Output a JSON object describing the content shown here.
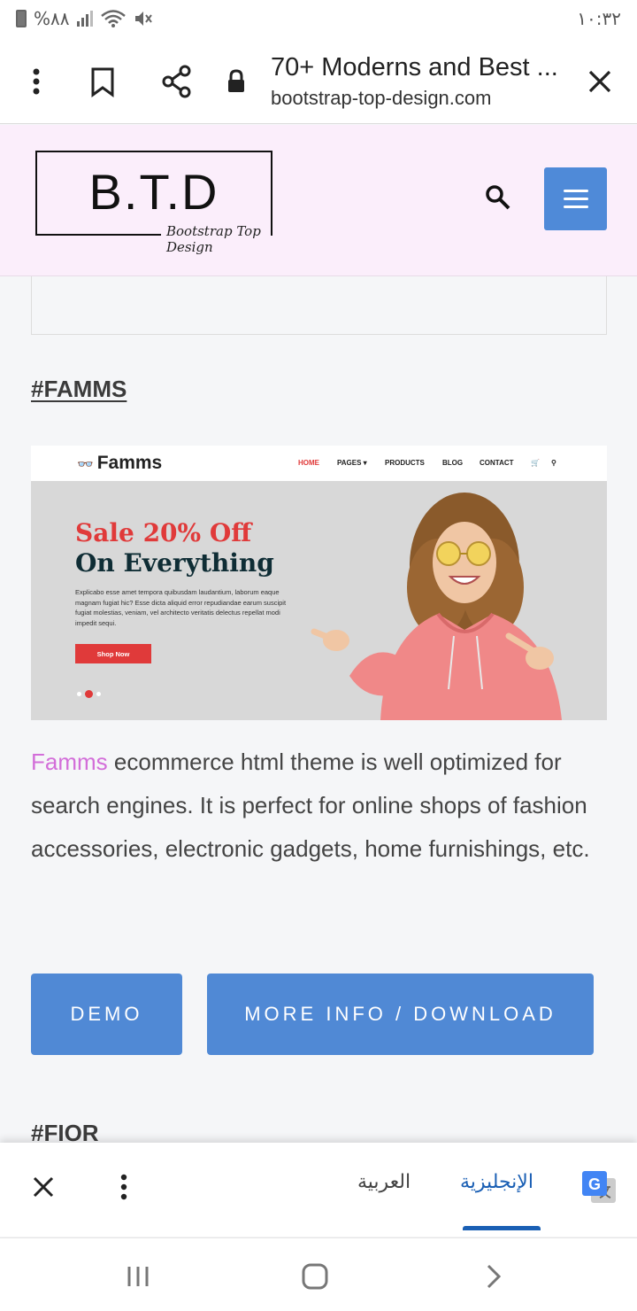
{
  "status_bar": {
    "battery_text": "%٨٨",
    "time": "١٠:٣٢"
  },
  "browser": {
    "tab_title": "70+ Moderns and Best ...",
    "url": "bootstrap-top-design.com"
  },
  "site": {
    "logo_main": "B.T.D",
    "logo_sub": "Bootstrap Top Design"
  },
  "content": {
    "section_heading": "#FAMMS",
    "next_heading": "#FIOR",
    "preview": {
      "logo": "Famms",
      "menu": [
        "HOME",
        "PAGES ▾",
        "PRODUCTS",
        "BLOG",
        "CONTACT"
      ],
      "sale_line": "Sale 20% Off",
      "sale_line2": "On Everything",
      "description": "Explicabo esse amet tempora quibusdam laudantium, laborum eaque magnam fugiat hic? Esse dicta aliquid error repudiandae earum suscipit fugiat molestias, veniam, vel architecto veritatis delectus repellat modi impedit sequi.",
      "button": "Shop Now"
    },
    "description_brand": "Famms",
    "description_rest": " ecommerce html theme is well optimized for search engines. It is perfect for online shops of fashion accessories, electronic gadgets, home furnishings, etc.",
    "demo_button": "DEMO",
    "download_button": "MORE INFO / DOWNLOAD"
  },
  "translate_bar": {
    "lang_arabic": "العربية",
    "lang_english": "الإنجليزية"
  },
  "colors": {
    "accent_blue": "#5089d5",
    "header_pink": "#fbeefb",
    "brand_pink": "#d36ed9",
    "famms_red": "#e03a3a"
  }
}
